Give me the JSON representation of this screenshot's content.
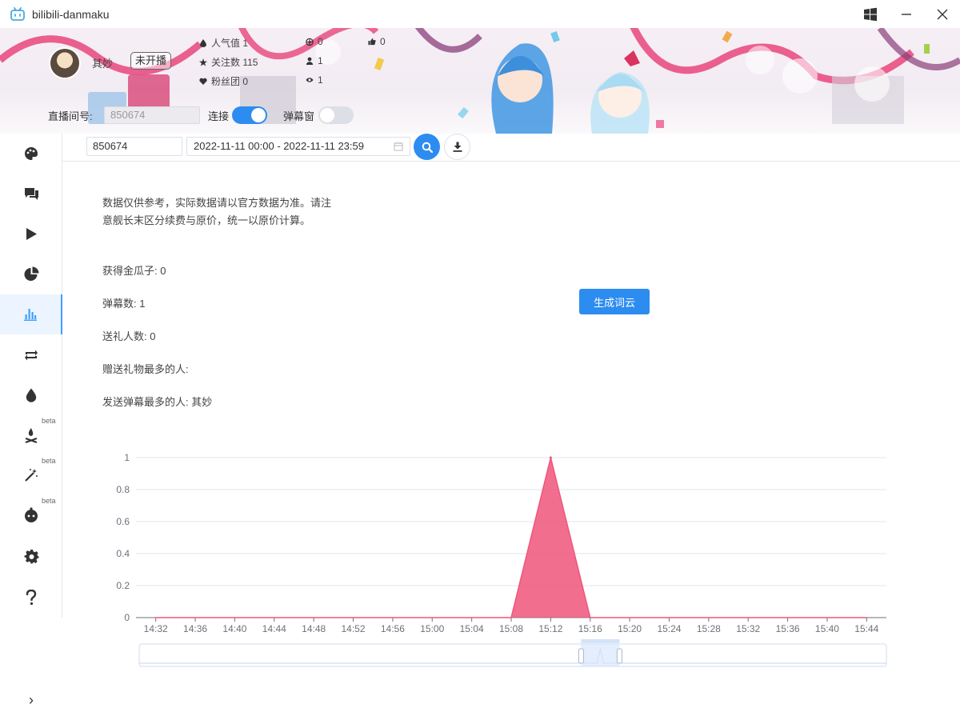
{
  "window": {
    "title": "bilibili-danmaku"
  },
  "banner": {
    "username": "其妙",
    "live_status": "未开播",
    "stats": {
      "popularity_label": "人气值 1",
      "followers_label": "关注数 115",
      "fan_club_label": "粉丝团 0",
      "gift_count": "0",
      "user_count": "1",
      "view_count": "1",
      "like_count": "0"
    },
    "room_label": "直播间号:",
    "room_value": "850674",
    "connect_label": "连接",
    "danmaku_window_label": "弹幕窗",
    "connect_on": true,
    "danmaku_window_on": false
  },
  "sidebar": {
    "items": [
      {
        "name": "palette",
        "beta": ""
      },
      {
        "name": "comments",
        "beta": ""
      },
      {
        "name": "play",
        "beta": ""
      },
      {
        "name": "pie-chart",
        "beta": ""
      },
      {
        "name": "bar-chart",
        "beta": "",
        "active": true
      },
      {
        "name": "repeat",
        "beta": ""
      },
      {
        "name": "drop",
        "beta": ""
      },
      {
        "name": "campfire",
        "beta": "beta"
      },
      {
        "name": "magic-wand",
        "beta": "beta"
      },
      {
        "name": "bot",
        "beta": "beta"
      },
      {
        "name": "gear",
        "beta": ""
      },
      {
        "name": "help",
        "beta": ""
      }
    ],
    "collapse_glyph": "›"
  },
  "toolbar": {
    "room_value": "850674",
    "date_range": "2022-11-11 00:00 - 2022-11-11 23:59"
  },
  "stats_panel": {
    "note": "数据仅供参考，实际数据请以官方数据为准。请注意舰长末区分续费与原价，统一以原价计算。",
    "gold_label": "获得金瓜子: 0",
    "danmaku_label": "弹幕数: 1",
    "gift_users_label": "送礼人数: 0",
    "top_gifter_label": "赠送礼物最多的人:",
    "top_sender_label": "发送弹幕最多的人: 其妙",
    "wordcloud_button": "生成词云"
  },
  "colors": {
    "accent": "#2d8cf0",
    "series": "#f0557b"
  },
  "chart_data": {
    "type": "area",
    "x": [
      "14:32",
      "14:36",
      "14:40",
      "14:44",
      "14:48",
      "14:52",
      "14:56",
      "15:00",
      "15:04",
      "15:08",
      "15:12",
      "15:16",
      "15:20",
      "15:24",
      "15:28",
      "15:32",
      "15:36",
      "15:40",
      "15:44"
    ],
    "series": [
      {
        "values": [
          0,
          0,
          0,
          0,
          0,
          0,
          0,
          0,
          0,
          0,
          1,
          0,
          0,
          0,
          0,
          0,
          0,
          0,
          0
        ]
      }
    ],
    "y_ticks": [
      "0",
      "0.2",
      "0.4",
      "0.6",
      "0.8",
      "1"
    ],
    "ylim": [
      0,
      1
    ],
    "grid": true,
    "data_zoom_slider": true
  }
}
